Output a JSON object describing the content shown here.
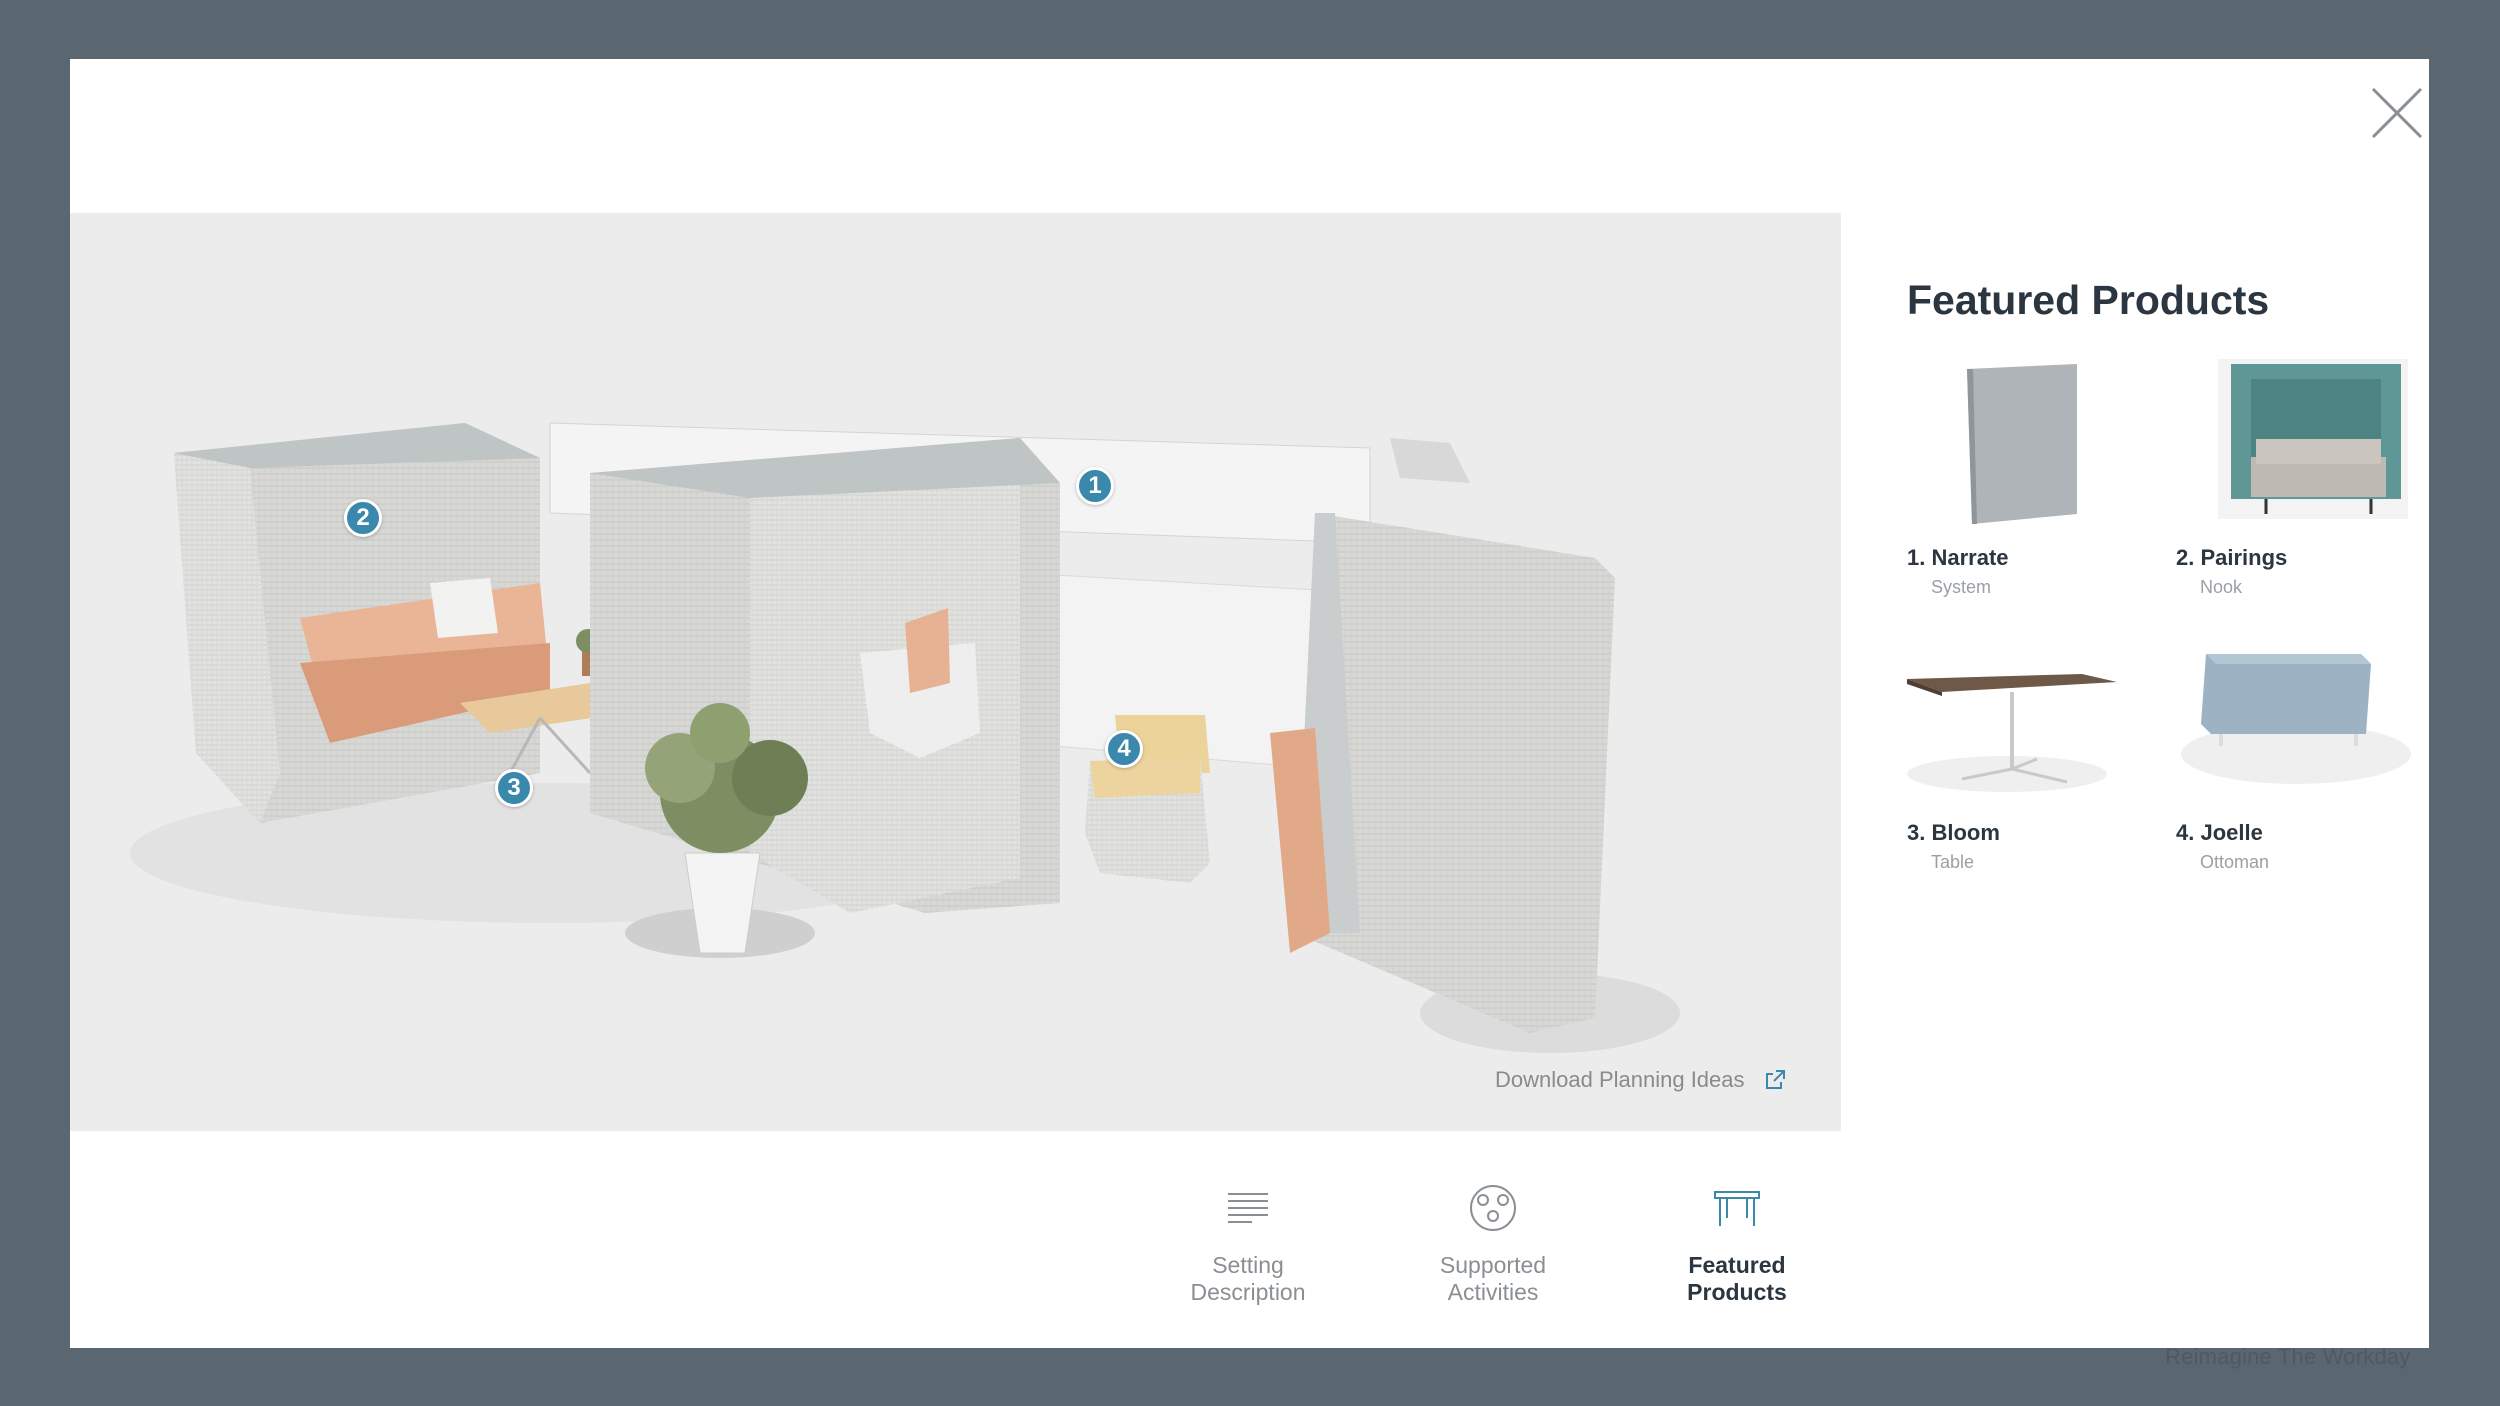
{
  "close": {
    "label": "X"
  },
  "scene": {
    "markers": [
      "1",
      "2",
      "3",
      "4"
    ],
    "download_label": "Download Planning Ideas"
  },
  "featured": {
    "title": "Featured Products",
    "products": [
      {
        "name": "1. Narrate",
        "sub": "System"
      },
      {
        "name": "2. Pairings",
        "sub": "Nook"
      },
      {
        "name": "3. Bloom",
        "sub": "Table"
      },
      {
        "name": "4. Joelle",
        "sub": "Ottoman"
      }
    ]
  },
  "tabs": [
    {
      "line1": "Setting",
      "line2": "Description",
      "active": false
    },
    {
      "line1": "Supported",
      "line2": "Activities",
      "active": false
    },
    {
      "line1": "Featured",
      "line2": "Products",
      "active": true
    }
  ],
  "footer": {
    "text": "Reimagine The Workday"
  },
  "colors": {
    "backdrop": "#5a6670",
    "marker": "#3a88ac",
    "title": "#2c3640",
    "active_tab_icon": "#3a88ac"
  }
}
